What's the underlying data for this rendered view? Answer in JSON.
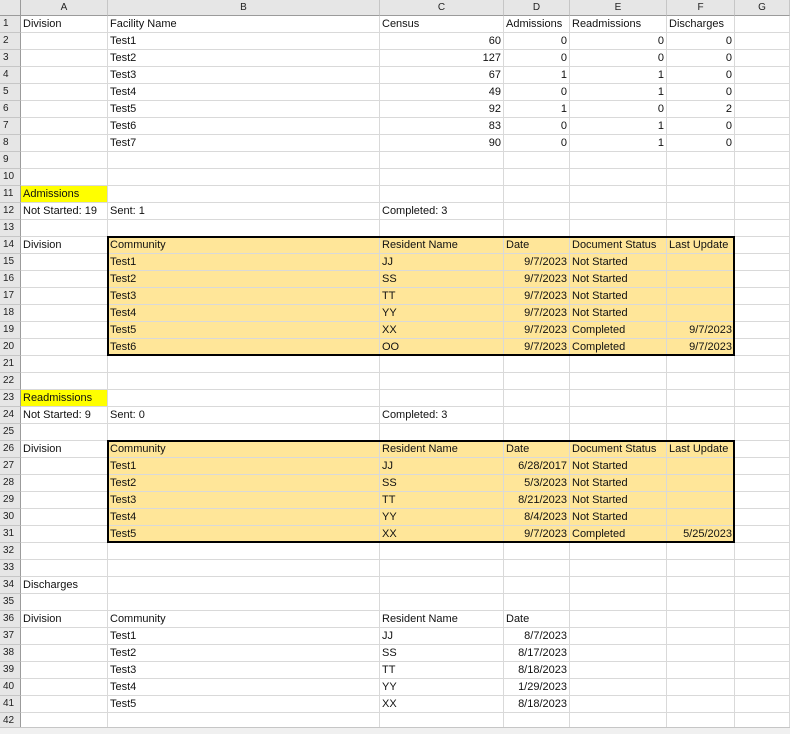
{
  "columns": [
    "A",
    "B",
    "C",
    "D",
    "E",
    "F",
    "G"
  ],
  "row_numbers": [
    "1",
    "2",
    "3",
    "4",
    "5",
    "6",
    "7",
    "8",
    "9",
    "10",
    "11",
    "12",
    "13",
    "14",
    "15",
    "16",
    "17",
    "18",
    "19",
    "20",
    "21",
    "22",
    "23",
    "24",
    "25",
    "26",
    "27",
    "28",
    "29",
    "30",
    "31",
    "32",
    "33",
    "34",
    "35",
    "36",
    "37",
    "38",
    "39",
    "40",
    "41",
    "42"
  ],
  "summary": {
    "headers": [
      "Division",
      "Facility Name",
      "Census",
      "Admissions",
      "Readmissions",
      "Discharges"
    ],
    "rows": [
      [
        "",
        "Test1",
        "60",
        "0",
        "0",
        "0"
      ],
      [
        "",
        "Test2",
        "127",
        "0",
        "0",
        "0"
      ],
      [
        "",
        "Test3",
        "67",
        "1",
        "1",
        "0"
      ],
      [
        "",
        "Test4",
        "49",
        "0",
        "1",
        "0"
      ],
      [
        "",
        "Test5",
        "92",
        "1",
        "0",
        "2"
      ],
      [
        "",
        "Test6",
        "83",
        "0",
        "1",
        "0"
      ],
      [
        "",
        "Test7",
        "90",
        "0",
        "1",
        "0"
      ]
    ]
  },
  "admissions": {
    "title": "Admissions",
    "not_started": "Not Started: 19",
    "sent": "Sent: 1",
    "completed": "Completed: 3",
    "headers": [
      "Division",
      "Community",
      "Resident Name",
      "Date",
      "Document Status",
      "Last Update"
    ],
    "rows": [
      [
        "",
        "Test1",
        "JJ",
        "9/7/2023",
        "Not Started",
        ""
      ],
      [
        "",
        "Test2",
        "SS",
        "9/7/2023",
        "Not Started",
        ""
      ],
      [
        "",
        "Test3",
        "TT",
        "9/7/2023",
        "Not Started",
        ""
      ],
      [
        "",
        "Test4",
        "YY",
        "9/7/2023",
        "Not Started",
        ""
      ],
      [
        "",
        "Test5",
        "XX",
        "9/7/2023",
        "Completed",
        "9/7/2023"
      ],
      [
        "",
        "Test6",
        "OO",
        "9/7/2023",
        "Completed",
        "9/7/2023"
      ]
    ]
  },
  "readmissions": {
    "title": "Readmissions",
    "not_started": "Not Started: 9",
    "sent": "Sent: 0",
    "completed": "Completed: 3",
    "headers": [
      "Division",
      "Community",
      "Resident Name",
      "Date",
      "Document Status",
      "Last Update"
    ],
    "rows": [
      [
        "",
        "Test1",
        "JJ",
        "6/28/2017",
        "Not Started",
        ""
      ],
      [
        "",
        "Test2",
        "SS",
        "5/3/2023",
        "Not Started",
        ""
      ],
      [
        "",
        "Test3",
        "TT",
        "8/21/2023",
        "Not Started",
        ""
      ],
      [
        "",
        "Test4",
        "YY",
        "8/4/2023",
        "Not Started",
        ""
      ],
      [
        "",
        "Test5",
        "XX",
        "9/7/2023",
        "Completed",
        "5/25/2023"
      ]
    ]
  },
  "discharges": {
    "title": "Discharges",
    "headers": [
      "Division",
      "Community",
      "Resident Name",
      "Date"
    ],
    "rows": [
      [
        "",
        "Test1",
        "JJ",
        "8/7/2023"
      ],
      [
        "",
        "Test2",
        "SS",
        "8/17/2023"
      ],
      [
        "",
        "Test3",
        "TT",
        "8/18/2023"
      ],
      [
        "",
        "Test4",
        "YY",
        "1/29/2023"
      ],
      [
        "",
        "Test5",
        "XX",
        "8/18/2023"
      ]
    ]
  }
}
